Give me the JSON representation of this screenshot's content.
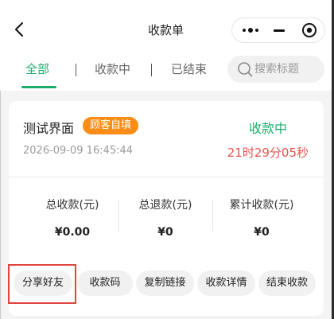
{
  "navbar": {
    "title": "收款单",
    "back_icon": "chevron-left-icon",
    "capsule": {
      "more_icon": "more-dots-icon",
      "minimize_icon": "minimize-icon",
      "close_icon": "target-close-icon"
    }
  },
  "tabs": {
    "items": [
      {
        "label": "全部",
        "active": true
      },
      {
        "label": "收款中",
        "active": false
      },
      {
        "label": "已结束",
        "active": false
      }
    ],
    "separator": "|",
    "search": {
      "placeholder": "搜索标题",
      "value": "",
      "icon": "search-icon"
    }
  },
  "record": {
    "title": "测试界面",
    "badge": "顾客自填",
    "status": "收款中",
    "created_at": "2026-09-09 16:45:44",
    "countdown": "21时29分05秒",
    "stats": [
      {
        "label": "总收款(元)",
        "value": "¥0.00"
      },
      {
        "label": "总退款(元)",
        "value": "¥0"
      },
      {
        "label": "累计收款(元)",
        "value": "¥0"
      }
    ],
    "actions": [
      {
        "label": "分享好友",
        "highlighted": true
      },
      {
        "label": "收款码"
      },
      {
        "label": "复制链接"
      },
      {
        "label": "收款详情"
      },
      {
        "label": "结束收款"
      }
    ]
  },
  "colors": {
    "accent_green": "#1aad6a",
    "badge_orange": "#fc8c18",
    "countdown_red": "#e5564f",
    "highlight_red": "#e0443e"
  }
}
